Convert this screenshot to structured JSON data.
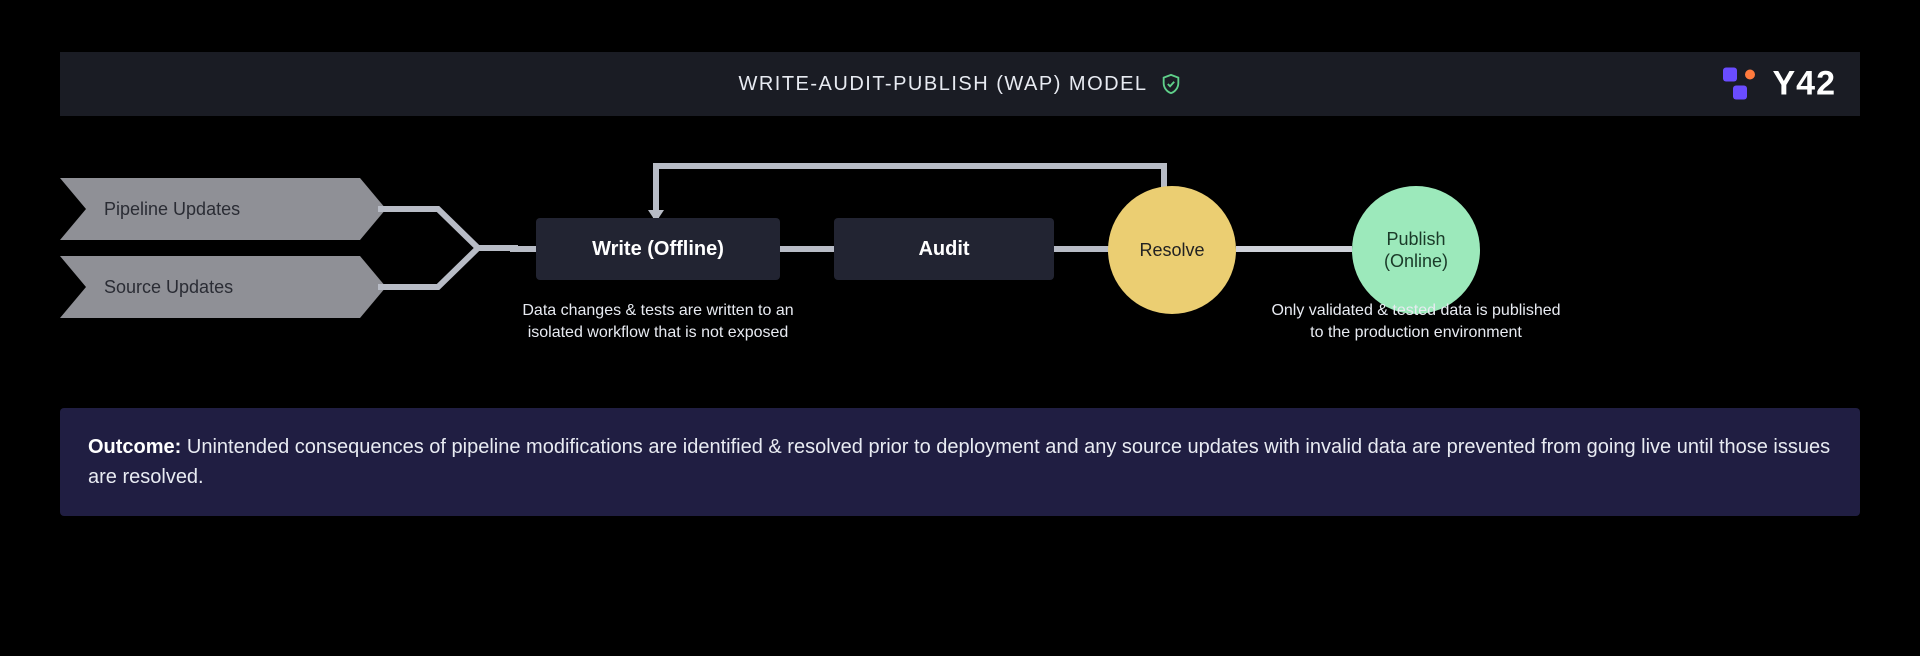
{
  "header": {
    "title": "WRITE-AUDIT-PUBLISH (WAP) MODEL",
    "logo_text": "Y42"
  },
  "inputs": {
    "pipeline": "Pipeline Updates",
    "source": "Source Updates"
  },
  "nodes": {
    "write": "Write (Offline)",
    "audit": "Audit",
    "resolve": "Resolve",
    "publish": "Publish (Online)"
  },
  "captions": {
    "write": "Data changes & tests are written to an isolated workflow that is not exposed",
    "publish": "Only validated & tested data is published to the production environment"
  },
  "outcome": {
    "label": "Outcome:",
    "text": "Unintended consequences of pipeline modifications are identified & resolved prior to deployment and any source updates with invalid data are prevented from going live until those issues are resolved."
  }
}
